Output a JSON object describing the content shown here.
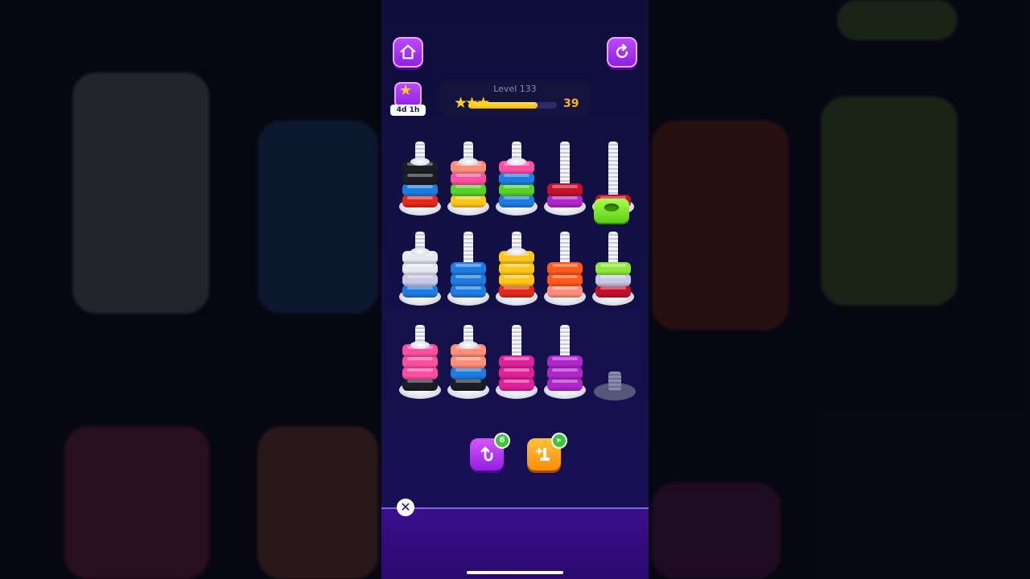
{
  "header": {
    "home_button_icon": "home-icon",
    "restart_button_icon": "restart-icon"
  },
  "event": {
    "icon": "star-trophy-icon",
    "timer": "4d 1h"
  },
  "level": {
    "title": "Level 133",
    "stars": "★★★",
    "progress_fraction": 0.78,
    "count": "39"
  },
  "colors": {
    "black": "#1c1c24",
    "red": "#e22a1a",
    "blue": "#1e7be0",
    "salmon": "#ff8f7a",
    "pink": "#ff4fa2",
    "green": "#55d12a",
    "yellow": "#ffc61a",
    "white": "#e8e8f2",
    "darkred": "#c4102a",
    "purple": "#b026c8",
    "magenta": "#e0209a",
    "lime": "#8fe63a",
    "orange": "#ff5a1a",
    "lavender": "#c8c8e8"
  },
  "screws": [
    {
      "nuts": [
        "red",
        "blue",
        "black",
        "black"
      ],
      "capped": true
    },
    {
      "nuts": [
        "yellow",
        "green",
        "pink",
        "salmon"
      ],
      "capped": true
    },
    {
      "nuts": [
        "blue",
        "green",
        "blue",
        "pink"
      ],
      "capped": true
    },
    {
      "nuts": [
        "purple",
        "darkred"
      ],
      "capped": false
    },
    {
      "nuts": [
        "darkred"
      ],
      "capped": false
    },
    {
      "nuts": [
        "blue",
        "lavender",
        "white",
        "white"
      ],
      "capped": true
    },
    {
      "nuts": [
        "blue",
        "blue",
        "blue"
      ],
      "capped": false
    },
    {
      "nuts": [
        "red",
        "yellow",
        "yellow",
        "yellow"
      ],
      "capped": true
    },
    {
      "nuts": [
        "salmon",
        "orange",
        "orange"
      ],
      "capped": false
    },
    {
      "nuts": [
        "darkred",
        "lavender",
        "lime"
      ],
      "capped": false
    },
    {
      "nuts": [
        "black",
        "pink",
        "pink",
        "pink"
      ],
      "capped": true
    },
    {
      "nuts": [
        "black",
        "blue",
        "salmon",
        "salmon"
      ],
      "capped": true
    },
    {
      "nuts": [
        "magenta",
        "magenta",
        "magenta"
      ],
      "capped": false
    },
    {
      "nuts": [
        "purple",
        "purple",
        "purple"
      ],
      "capped": false
    }
  ],
  "held_nut": {
    "color": "lime",
    "icon": "nut-icon"
  },
  "boosters": {
    "undo": {
      "icon": "undo-icon",
      "count": "6"
    },
    "add_screw": {
      "icon": "add-screw-icon",
      "badge_icon": "video-ad-icon"
    }
  },
  "ad": {
    "close_icon": "close-icon",
    "close_label": "✕"
  }
}
